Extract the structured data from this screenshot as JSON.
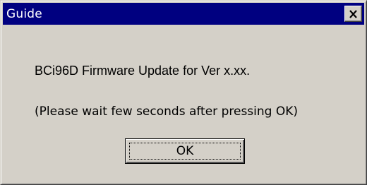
{
  "window": {
    "title": "Guide",
    "close_icon": "close-icon"
  },
  "content": {
    "message": "BCi96D Firmware Update for Ver x.xx.",
    "note": "(Please wait few seconds after pressing OK)"
  },
  "buttons": {
    "ok_label": "OK"
  },
  "colors": {
    "titlebar": "#000080",
    "face": "#d4d0c8",
    "title_text": "#ffffff"
  }
}
